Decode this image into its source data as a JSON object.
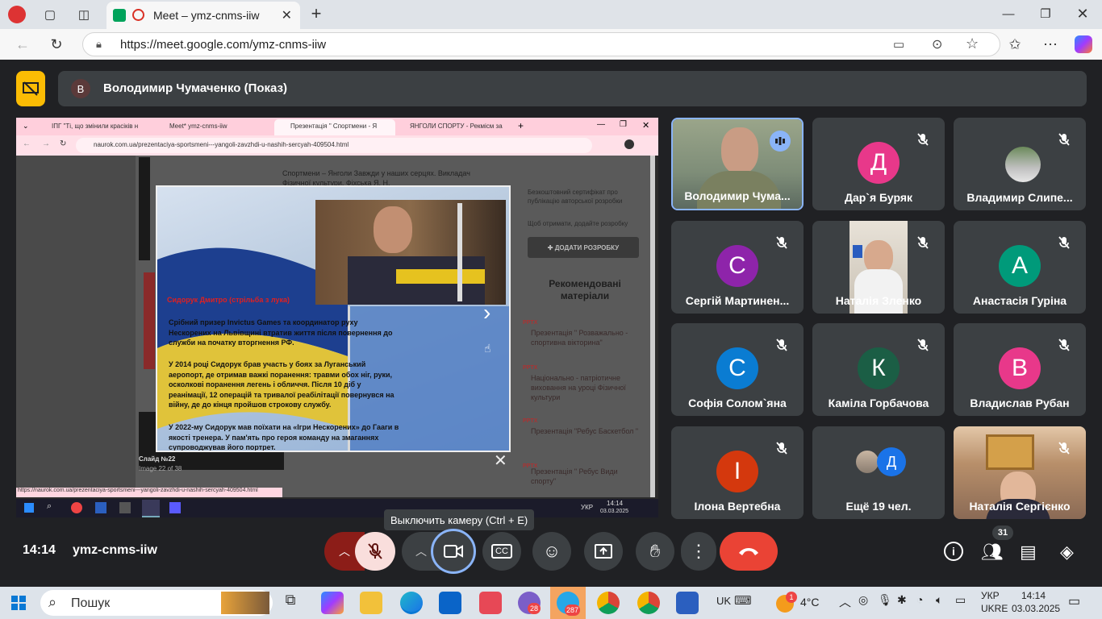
{
  "browser": {
    "tab_title": "Meet – ymz-cnms-iiw",
    "url": "https://meet.google.com/ymz-cnms-iiw"
  },
  "meet": {
    "presenter_initial": "В",
    "presenter_label": "Володимир Чумаченко (Показ)",
    "tooltip": "Выключить камеру (Ctrl + E)",
    "time": "14:14",
    "code": "ymz-cnms-iiw",
    "participants_count": "31"
  },
  "shared": {
    "tabs": [
      "ІПГ \"Ті, що змінили красіків н",
      "Meet* ymz-cnms-iiw",
      "Презентація \" Спортмени - Я",
      "ЯНГОЛИ СПОРТУ - Рекмісм за"
    ],
    "url": "naurok.com.ua/prezentaciya-sportsmeni---yangoli-zavzhdi-u-nashih-sercyah-409504.html",
    "page_desc": "Спортмени – Янголи Завжди у наших серцях. Викладач Фізичної культури. Фіхська Я. Н.",
    "cert_text": "Безкоштовний сертифікат про публікацію авторської розробки",
    "cert_sub": "Щоб отримати, додайте розробку",
    "add_btn": "✚ ДОДАТИ РОЗРОБКУ",
    "recommended": "Рекомендовані матеріали",
    "rec_items": [
      {
        "tag": "PPTX",
        "title": "Презентація \" Розважально - спортивна вікторина\""
      },
      {
        "tag": "PPTX",
        "title": "Національно - патріотичне виховання на уроці Фізичної культури"
      },
      {
        "tag": "PPTX",
        "title": "Презентація \"Ребус Баскетбол \""
      },
      {
        "tag": "PPTX",
        "title": "Презентація \" Ребус Види спорту\""
      }
    ],
    "slide_caption": "Слайд №22",
    "slide_sub": "Image 22 of 38",
    "status_url": "https://naurok.com.ua/prezentaciya-sportsmeni---yangoli-zavzhdi-u-nashih-sercyah-409504.html",
    "inner_lang": "УКР",
    "inner_time": "14:14",
    "inner_date": "03.03.2025"
  },
  "slide": {
    "heading": "Сидорук Дмитро (стрільба з лука)",
    "p1": "Срібний призер Invictus Games та координатор руху Нескорених на Львівщині втратив життя після повернення до служби на початку вторгнення РФ.",
    "p2": "У 2014 році Сидорук брав участь у боях за Луганський аеропорт, де отримав важкі поранення: травми обох ніг, руки, осколкові поранення легень і обличчя. Після 10 діб у реанімації, 12 операцій та тривалої реабілітації повернувся на війну, де до кінця пройшов строкову службу.",
    "p3": "У 2022-му Сидорук мав поїхати на «Ігри Нескорених» до Гааги в якості тренера. У пам'ять про героя команду на змаганнях супроводжував його портрет."
  },
  "participants": [
    {
      "initial": "",
      "name": "Володимир Чума...",
      "type": "video",
      "speaking": true
    },
    {
      "initial": "Д",
      "name": "Дар`я Буряк",
      "color": "#e8388a"
    },
    {
      "initial": "",
      "name": "Владимир Слипе...",
      "type": "photo"
    },
    {
      "initial": "С",
      "name": "Сергій Мартинен...",
      "color": "#8e24aa"
    },
    {
      "initial": "",
      "name": "Наталія Зленко",
      "type": "photo"
    },
    {
      "initial": "А",
      "name": "Анастасія Гуріна",
      "color": "#009a7a"
    },
    {
      "initial": "С",
      "name": "Софія Солом`яна",
      "color": "#0a7cd2"
    },
    {
      "initial": "К",
      "name": "Каміла Горбачова",
      "color": "#1b5e45"
    },
    {
      "initial": "В",
      "name": "Владислав Рубан",
      "color": "#e8388a"
    },
    {
      "initial": "І",
      "name": "Ілона Вертебна",
      "color": "#d4380d"
    },
    {
      "initial": "Д",
      "name": "Ещё 19 чел.",
      "color": "#1a73e8"
    },
    {
      "initial": "",
      "name": "Наталія Сергієнко",
      "type": "photo"
    }
  ],
  "taskbar": {
    "search": "Пошук",
    "chat_badge": "28",
    "tg_badge": "287",
    "lang1": "UK",
    "weather": "4°C",
    "weather_badge": "1",
    "lang_a": "УКР",
    "lang_b": "UKRE",
    "time": "14:14",
    "date": "03.03.2025"
  },
  "colors": {
    "accent": "#1a73e8",
    "end_call": "#ea4335",
    "mic_off": "#f9dedc",
    "presenter_icon": "#fbbc04"
  }
}
